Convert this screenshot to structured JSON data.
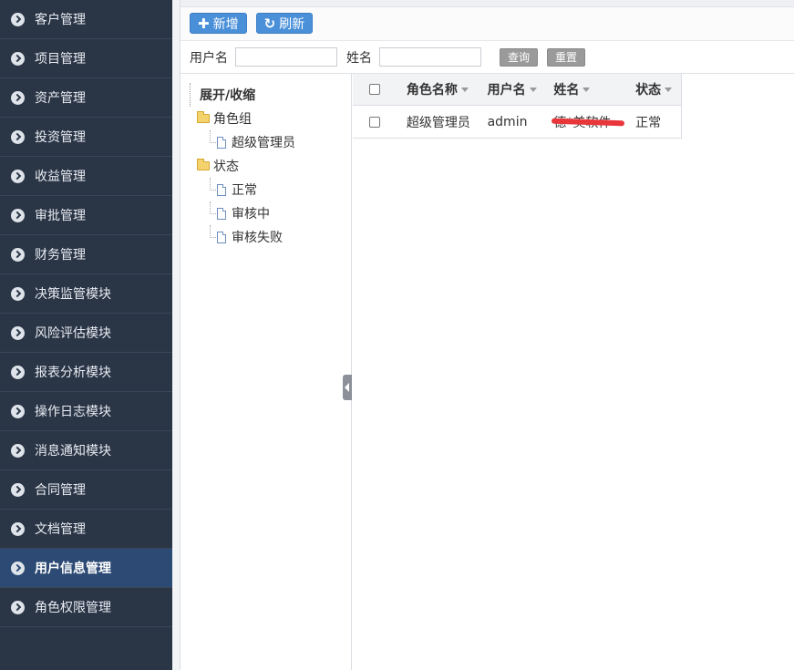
{
  "sidebar": {
    "items": [
      {
        "label": "客户管理"
      },
      {
        "label": "项目管理"
      },
      {
        "label": "资产管理"
      },
      {
        "label": "投资管理"
      },
      {
        "label": "收益管理"
      },
      {
        "label": "审批管理"
      },
      {
        "label": "财务管理"
      },
      {
        "label": "决策监管模块"
      },
      {
        "label": "风险评估模块"
      },
      {
        "label": "报表分析模块"
      },
      {
        "label": "操作日志模块"
      },
      {
        "label": "消息通知模块"
      },
      {
        "label": "合同管理"
      },
      {
        "label": "文档管理"
      },
      {
        "label": "用户信息管理"
      },
      {
        "label": "角色权限管理"
      }
    ],
    "active_index": 14
  },
  "toolbar": {
    "add_label": "新增",
    "refresh_label": "刷新"
  },
  "search": {
    "username_label": "用户名",
    "username_value": "",
    "name_label": "姓名",
    "name_value": "",
    "query_label": "查询",
    "reset_label": "重置"
  },
  "tree": {
    "root": "展开/收缩",
    "group1": {
      "label": "角色组",
      "children": [
        "超级管理员"
      ]
    },
    "group2": {
      "label": "状态",
      "children": [
        "正常",
        "审核中",
        "审核失败"
      ]
    }
  },
  "grid": {
    "columns": [
      "角色名称",
      "用户名",
      "姓名",
      "状态"
    ],
    "rows": [
      {
        "role": "超级管理员",
        "username": "admin",
        "name": "德*美软件",
        "status": "正常"
      }
    ]
  },
  "colors": {
    "sidebar_bg": "#2a3546",
    "sidebar_active": "#2c4a74",
    "primary_button": "#4a90d9",
    "gray_button": "#9a9a9a"
  }
}
